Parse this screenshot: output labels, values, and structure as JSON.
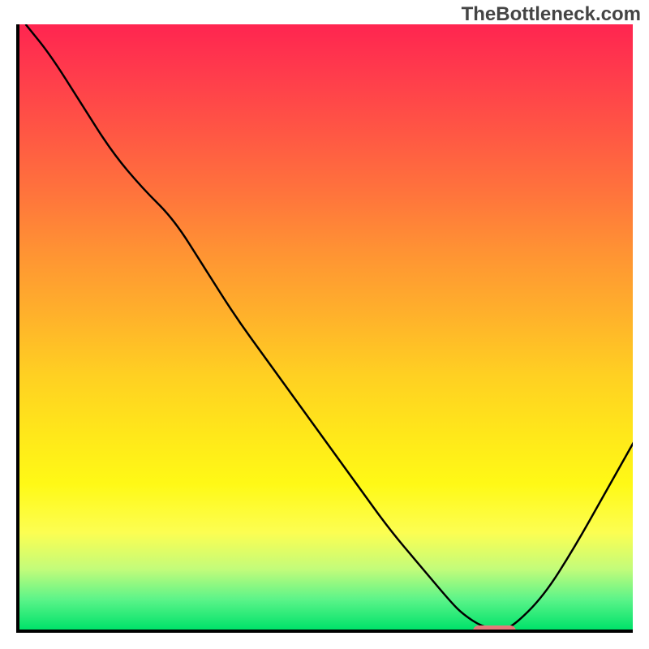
{
  "watermark": "TheBottleneck.com",
  "colors": {
    "marker": "#e37a7a",
    "curve_stroke": "#000000",
    "axis": "#000000"
  },
  "chart_data": {
    "type": "line",
    "title": "",
    "xlabel": "",
    "ylabel": "",
    "xlim": [
      0,
      100
    ],
    "ylim": [
      0,
      100
    ],
    "x": [
      1,
      5,
      10,
      15,
      20,
      25,
      30,
      35,
      40,
      45,
      50,
      55,
      60,
      65,
      70,
      72,
      75,
      78,
      80,
      85,
      90,
      95,
      100
    ],
    "y": [
      100,
      95,
      87,
      79,
      73,
      68,
      60,
      52,
      45,
      38,
      31,
      24,
      17,
      11,
      5,
      3,
      1,
      0.5,
      1,
      6,
      14,
      23,
      32
    ],
    "optimal_x": 77,
    "marker_y": 0.3,
    "marker_width_x": 7
  }
}
